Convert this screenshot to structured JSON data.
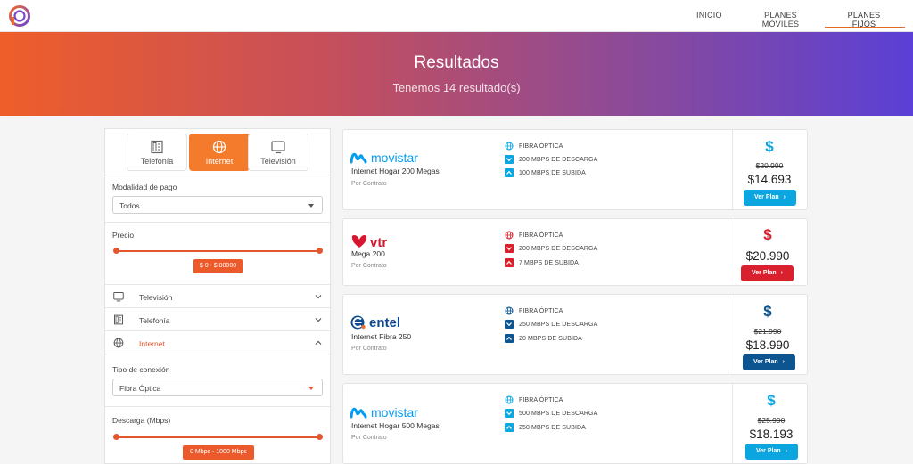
{
  "nav": {
    "items": [
      {
        "label": "INICIO"
      },
      {
        "label": "PLANES MÓVILES"
      },
      {
        "label": "PLANES FIJOS"
      }
    ]
  },
  "hero": {
    "title": "Resultados",
    "subtitle": "Tenemos 14 resultado(s)"
  },
  "sidebar": {
    "tabs": [
      {
        "label": "Telefonía",
        "icon": "phone-grid-icon"
      },
      {
        "label": "Internet",
        "icon": "globe-icon",
        "active": true
      },
      {
        "label": "Televisión",
        "icon": "tv-icon"
      }
    ],
    "payment": {
      "label": "Modalidad de pago",
      "value": "Todos"
    },
    "price": {
      "label": "Precio",
      "range": "$ 0 - $ 80000"
    },
    "accordion": [
      {
        "label": "Televisión",
        "icon": "tv-icon",
        "expanded": false
      },
      {
        "label": "Telefonía",
        "icon": "phone-grid-icon",
        "expanded": false
      },
      {
        "label": "Internet",
        "icon": "globe-icon",
        "expanded": true
      }
    ],
    "connection": {
      "label": "Tipo de conexión",
      "value": "Fibra Óptica"
    },
    "download": {
      "label": "Descarga (Mbps)",
      "range": "0 Mbps - 1000 Mbps"
    }
  },
  "plans": [
    {
      "brand": "movistar",
      "brand_color": "#019df4",
      "name": "Internet Hogar 200 Megas",
      "contract": "Por Contrato",
      "features": [
        "FIBRA ÓPTICA",
        "200 MBPS DE DESCARGA",
        "100 MBPS DE SUBIDA"
      ],
      "old_price": "$20.990",
      "price": "$14.693",
      "button": "Ver Plan",
      "accent": "#0ba5e0"
    },
    {
      "brand": "vtr",
      "brand_color": "#d7172f",
      "name": "Mega 200",
      "contract": "Por Contrato",
      "features": [
        "FIBRA ÓPTICA",
        "200 MBPS DE DESCARGA",
        "7 MBPS DE SUBIDA"
      ],
      "old_price": "",
      "price": "$20.990",
      "button": "Ver Plan",
      "accent": "#d9202f"
    },
    {
      "brand": "entel",
      "brand_color": "#0b4a8f",
      "name": "Internet Fibra 250",
      "contract": "Por Contrato",
      "features": [
        "FIBRA ÓPTICA",
        "250 MBPS DE DESCARGA",
        "20 MBPS DE SUBIDA"
      ],
      "old_price": "$21.990",
      "price": "$18.990",
      "button": "Ver Plan",
      "accent": "#0c5591"
    },
    {
      "brand": "movistar",
      "brand_color": "#019df4",
      "name": "Internet Hogar 500 Megas",
      "contract": "Por Contrato",
      "features": [
        "FIBRA ÓPTICA",
        "500 MBPS DE DESCARGA",
        "250 MBPS DE SUBIDA"
      ],
      "old_price": "$25.990",
      "price": "$18.193",
      "button": "Ver Plan",
      "accent": "#0ba5e0"
    }
  ]
}
